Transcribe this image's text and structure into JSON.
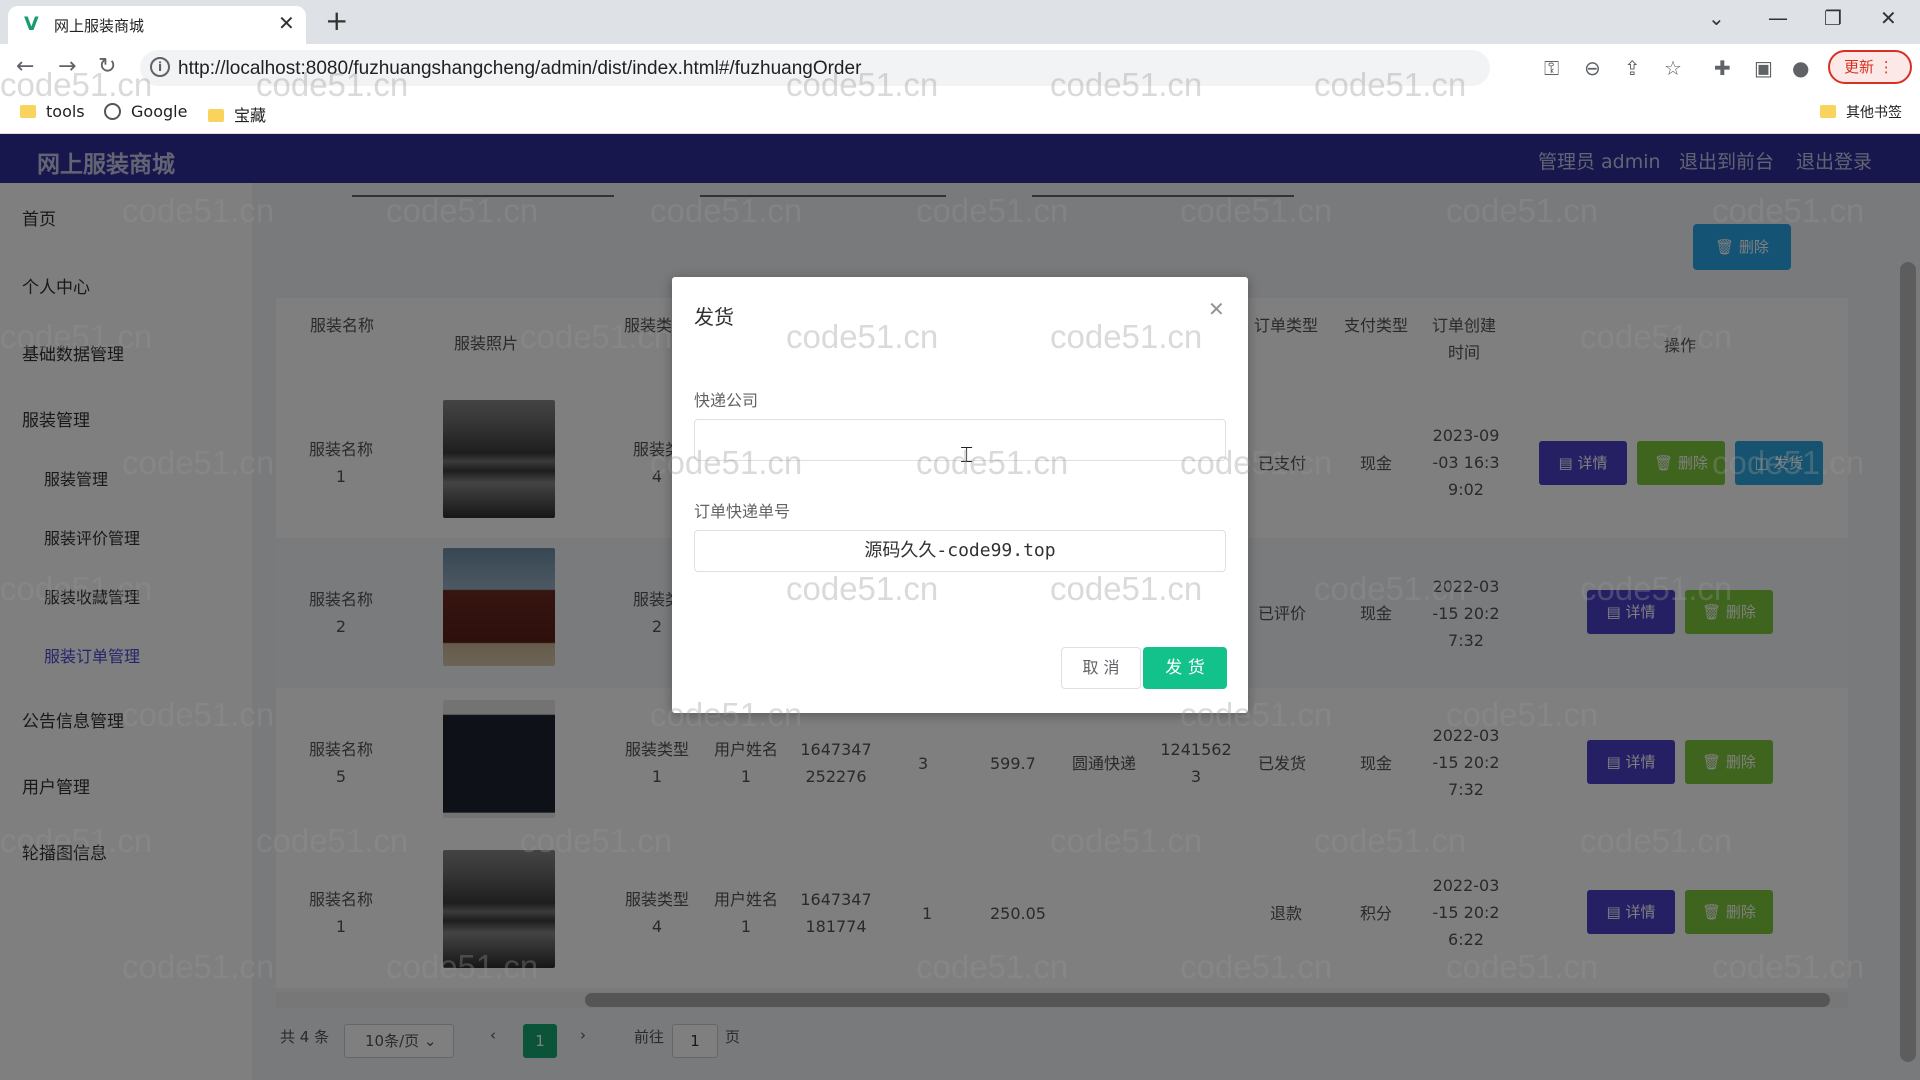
{
  "browser": {
    "tab_title": "网上服装商城",
    "tab_favicon": "V",
    "url": "http://localhost:8080/fuzhuangshangcheng/admin/dist/index.html#/fuzhuangOrder",
    "update_label": "更新",
    "bookmarks": [
      "tools",
      "Google",
      "宝藏"
    ],
    "other_bookmarks": "其他书签"
  },
  "header": {
    "title": "网上服装商城",
    "admin": "管理员 admin",
    "to_front": "退出到前台",
    "logout": "退出登录"
  },
  "sidebar": {
    "home": "首页",
    "personal": "个人中心",
    "basic_data": "基础数据管理",
    "clothing": "服装管理",
    "sub": [
      "服装管理",
      "服装评价管理",
      "服装收藏管理",
      "服装订单管理"
    ],
    "notice": "公告信息管理",
    "users": "用户管理",
    "carousel": "轮播图信息"
  },
  "toolbar": {
    "delete_label": "删除"
  },
  "table": {
    "headers": [
      "服装名称",
      "服装照片",
      "服装类",
      "订单类型",
      "支付类型",
      "订单创建时间",
      "操作"
    ],
    "rows": [
      {
        "name": "服装名称\n1",
        "type": "服装类\n4",
        "status": "已支付",
        "pay": "现金",
        "time": "2023-09\n-03 16:3\n9:02",
        "actions": [
          "详情",
          "删除",
          "发货"
        ]
      },
      {
        "name": "服装名称\n2",
        "type": "服装类\n2",
        "status": "已评价",
        "pay": "现金",
        "time": "2022-03\n-15 20:2\n7:32",
        "actions": [
          "详情",
          "删除"
        ]
      },
      {
        "name": "服装名称\n5",
        "type": "服装类型\n1",
        "user": "用户姓名\n1",
        "order_no": "1647347\n252276",
        "qty": "3",
        "price": "599.7",
        "express": "圆通快递",
        "tracking": "1241562\n3",
        "status": "已发货",
        "pay": "现金",
        "time": "2022-03\n-15 20:2\n7:32",
        "actions": [
          "详情",
          "删除"
        ]
      },
      {
        "name": "服装名称\n1",
        "type": "服装类型\n4",
        "user": "用户姓名\n1",
        "order_no": "1647347\n181774",
        "qty": "1",
        "price": "250.05",
        "express": "",
        "tracking": "",
        "status": "退款",
        "pay": "积分",
        "time": "2022-03\n-15 20:2\n6:22",
        "actions": [
          "详情",
          "删除"
        ]
      }
    ]
  },
  "pagination": {
    "total": "共 4 条",
    "page_size": "10条/页",
    "current": "1",
    "goto_prefix": "前往",
    "goto_value": "1",
    "goto_suffix": "页"
  },
  "dialog": {
    "title": "发货",
    "express_label": "快递公司",
    "express_value": "",
    "tracking_label": "订单快递单号",
    "tracking_value": "源码久久-code99.top",
    "cancel": "取 消",
    "confirm": "发 货"
  },
  "watermark": "code51.cn",
  "colors": {
    "header": "#2f2f9a",
    "detail": "#4a3fc9",
    "delete": "#7fc93b",
    "ship": "#2aa7e2",
    "confirm": "#13c28b",
    "active_menu": "#4b4bd8"
  }
}
